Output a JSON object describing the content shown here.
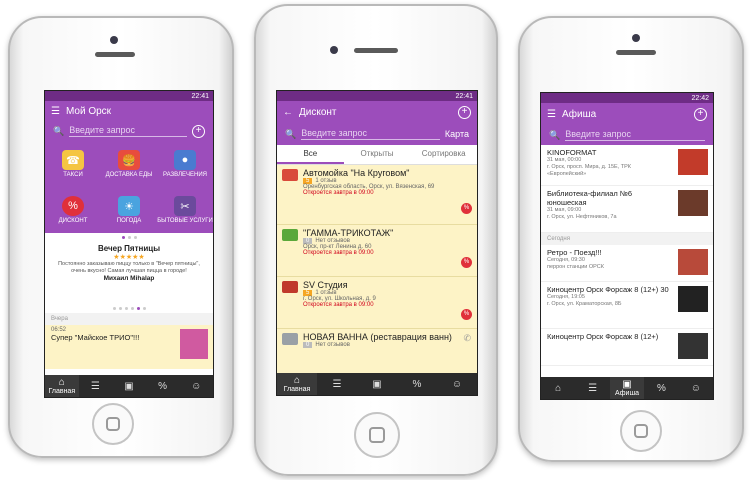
{
  "left": {
    "status_time": "22:41",
    "title": "Мой Орск",
    "search_placeholder": "Введите запрос",
    "categories": [
      {
        "label": "ТАКСИ",
        "icon": "taxi-icon",
        "color": "#f5c542"
      },
      {
        "label": "ДОСТАВКА ЕДЫ",
        "icon": "food-delivery-icon",
        "color": "#e84c3d"
      },
      {
        "label": "РАЗВЛЕЧЕНИЯ",
        "icon": "bowling-icon",
        "color": "#4a7bd0"
      },
      {
        "label": "ДИСКОНТ",
        "icon": "discount-icon",
        "color": "#e0303a"
      },
      {
        "label": "ПОГОДА",
        "icon": "weather-icon",
        "color": "#4aa3df"
      },
      {
        "label": "БЫТОВЫЕ УСЛУГИ",
        "icon": "services-icon",
        "color": "#6b4a9c"
      }
    ],
    "post_title": "Вечер Пятницы",
    "post_stars": "★★★★★",
    "post_text": "Постоянно заказываю пиццу только в \"Вечер пятницы\", очень вкусно! Самая лучшая пицца в городе!",
    "post_author": "Михаил Mihalap",
    "section": "Вчера",
    "feed_time": "06:52",
    "feed_title": "Супер \"Майское ТРИО\"!!!",
    "tab_home": "Главная"
  },
  "middle": {
    "status_time": "22:41",
    "title": "Дисконт",
    "search_placeholder": "Введите запрос",
    "map_label": "Карта",
    "segments": [
      "Все",
      "Открыты",
      "Сортировка"
    ],
    "items": [
      {
        "title": "Автомойка \"На Круговом\"",
        "rating": "5",
        "reviews": "1 отзыв",
        "address": "Оренбургская область, Орск, ул. Вязенская, 69",
        "status": "Откроется завтра в 09:00",
        "logo_color": "#d94a3a"
      },
      {
        "title": "\"ГАММА-ТРИКОТАЖ\"",
        "rating": "0",
        "reviews": "Нет отзывов",
        "address": "Орск, пр-кт Ленина д. 60",
        "status": "Откроется завтра в 09:00",
        "logo_color": "#5aa83a"
      },
      {
        "title": "SV Студия",
        "rating": "5",
        "reviews": "1 отзыв",
        "address": "г. Орск, ул. Школьная, д. 9",
        "status": "Откроется завтра в 09:00",
        "logo_color": "#c0392b"
      },
      {
        "title": "НОВАЯ ВАННА (реставрация ванн)",
        "rating": "0",
        "reviews": "Нет отзывов",
        "address": "",
        "status": "",
        "logo_color": "#9aa0a6"
      }
    ],
    "tab_home": "Главная"
  },
  "right": {
    "status_time": "22:42",
    "title": "Афиша",
    "search_placeholder": "Введите запрос",
    "events_top": [
      {
        "title": "KINOFORMAT",
        "date": "31 мая, 00:00",
        "place": "г. Орск, просп. Мира, д. 15Е, ТРК «Европейский»",
        "color": "#c23b2a"
      },
      {
        "title": "Библиотека-филиал №6 юношеская",
        "date": "31 мая, 09:00",
        "place": "г. Орск, ул. Нефтяников, 7а",
        "color": "#6b3a2a"
      }
    ],
    "section": "Сегодня",
    "events_today": [
      {
        "title": "Ретро - Поезд!!!",
        "date": "Сегодня, 09:30",
        "place": "перрон станции ОРСК",
        "color": "#b84a3a"
      },
      {
        "title": "Киноцентр Орск Форсаж 8 (12+) 30",
        "date": "Сегодня, 19:05",
        "place": "г. Орск, ул. Краматорская, 8Б",
        "color": "#222"
      },
      {
        "title": "Киноцентр Орск Форсаж 8 (12+)",
        "date": "",
        "place": "",
        "color": "#333"
      }
    ],
    "tab_active": "Афиша"
  }
}
